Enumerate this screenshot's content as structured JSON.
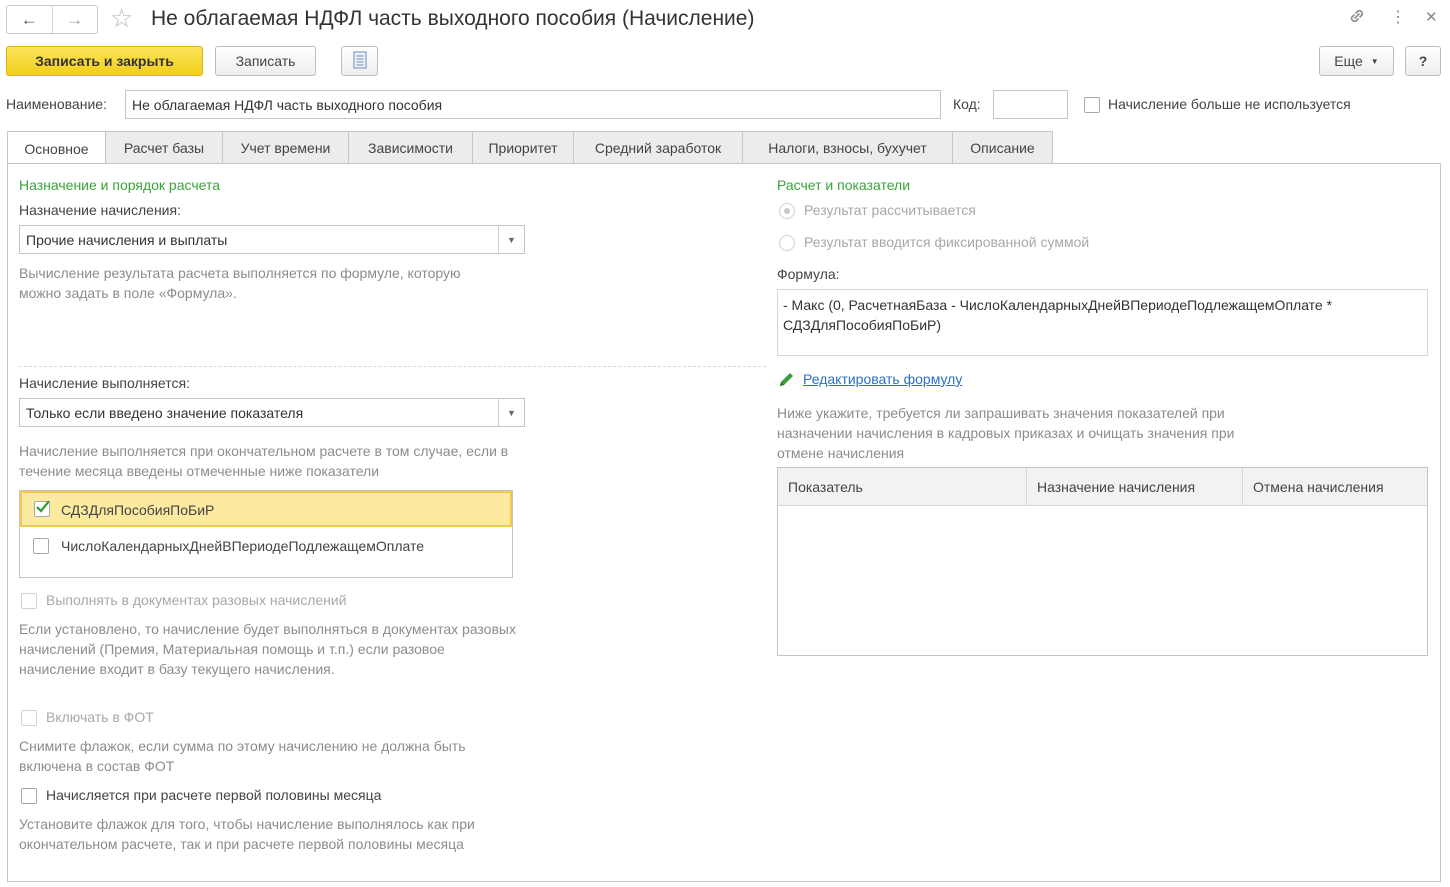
{
  "window": {
    "title": "Не облагаемая НДФЛ часть выходного пособия (Начисление)",
    "icons": [
      "back-arrow-icon",
      "forward-arrow-icon",
      "favorite-star-icon",
      "link-icon",
      "more-vertical-icon",
      "close-icon"
    ]
  },
  "toolbar": {
    "save_close": "Записать и закрыть",
    "save": "Записать",
    "more": "Еще",
    "help": "?"
  },
  "header": {
    "name_label": "Наименование:",
    "name_value": "Не облагаемая НДФЛ часть выходного пособия",
    "code_label": "Код:",
    "code_value": "",
    "unused_label": "Начисление больше не используется",
    "unused_checked": false
  },
  "tabs": [
    {
      "label": "Основное",
      "active": true
    },
    {
      "label": "Расчет базы",
      "active": false
    },
    {
      "label": "Учет времени",
      "active": false
    },
    {
      "label": "Зависимости",
      "active": false
    },
    {
      "label": "Приоритет",
      "active": false
    },
    {
      "label": "Средний заработок",
      "active": false
    },
    {
      "label": "Налоги, взносы, бухучет",
      "active": false
    },
    {
      "label": "Описание",
      "active": false
    }
  ],
  "left": {
    "section_title": "Назначение и порядок расчета",
    "purpose_label": "Назначение начисления:",
    "purpose_value": "Прочие начисления и выплаты",
    "purpose_hint": "Вычисление результата расчета выполняется по формуле, которую можно задать в поле «Формула».",
    "exec_label": "Начисление выполняется:",
    "exec_value": "Только если введено значение показателя",
    "exec_hint": "Начисление выполняется при окончательном расчете в том случае, если в течение месяца введены отмеченные ниже показатели",
    "indicators": [
      {
        "label": "СДЗДляПособияПоБиР",
        "checked": true
      },
      {
        "label": "ЧислоКалендарныхДнейВПериодеПодлежащемОплате",
        "checked": false
      }
    ],
    "onetime_label": "Выполнять в документах разовых начислений",
    "onetime_hint": "Если установлено, то начисление будет выполняться в документах разовых начислений (Премия, Материальная помощь и т.п.) если разовое начисление входит в базу текущего начисления.",
    "fot_label": "Включать в ФОТ",
    "fot_hint": "Снимите флажок, если сумма по этому начислению не должна быть включена в состав ФОТ",
    "firsthalf_label": "Начисляется при расчете первой половины месяца",
    "firsthalf_hint": "Установите флажок для того, чтобы начисление выполнялось как при окончательном расчете, так и при расчете первой половины месяца"
  },
  "right": {
    "section_title": "Расчет и показатели",
    "radio_calc": "Результат рассчитывается",
    "radio_fixed": "Результат вводится фиксированной суммой",
    "formula_label": "Формула:",
    "formula_line1": "- Макс (0, РасчетнаяБаза - ЧислоКалендарныхДнейВПериодеПодлежащемОплате *",
    "formula_line2": "СДЗДляПособияПоБиР)",
    "edit_link": "Редактировать формулу",
    "table_hint": "Ниже укажите, требуется ли запрашивать значения показателей при назначении начисления в кадровых приказах и очищать значения при отмене начисления",
    "table_headers": [
      "Показатель",
      "Назначение начисления",
      "Отмена начисления"
    ]
  }
}
